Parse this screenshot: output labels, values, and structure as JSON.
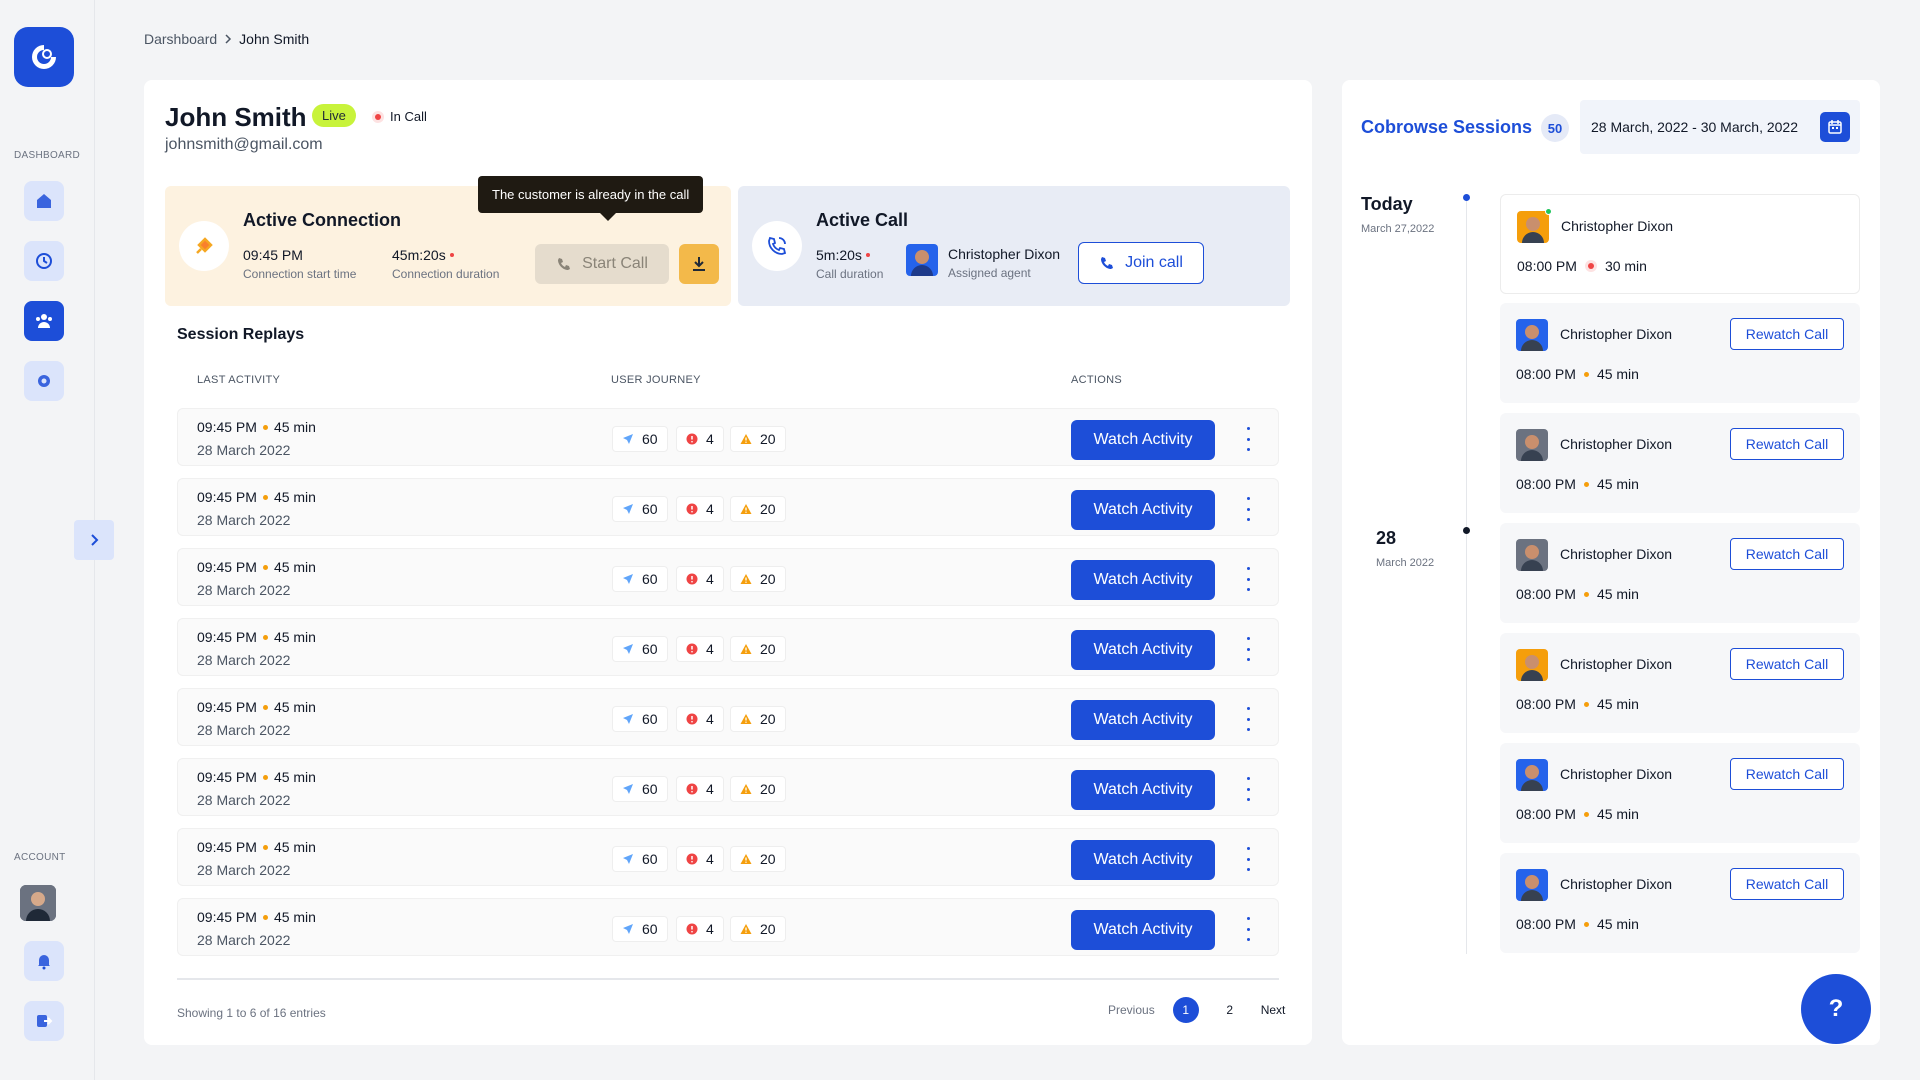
{
  "sidebar": {
    "dashboard_label": "DASHBOARD",
    "account_label": "ACCOUNT",
    "items": [
      {
        "icon": "home-icon"
      },
      {
        "icon": "clock-icon"
      },
      {
        "icon": "users-icon"
      },
      {
        "icon": "settings-icon"
      }
    ]
  },
  "breadcrumb": {
    "root": "Darshboard",
    "current": "John Smith"
  },
  "user": {
    "name": "John Smith",
    "status_badge": "Live",
    "call_status": "In Call",
    "email": "johnsmith@gmail.com"
  },
  "active_connection": {
    "title": "Active Connection",
    "start_time": "09:45 PM",
    "start_time_label": "Connection start time",
    "duration": "45m:20s",
    "duration_label": "Connection duration",
    "start_call_label": "Start Call",
    "tooltip": "The customer is already in the call"
  },
  "active_call": {
    "title": "Active Call",
    "duration": "5m:20s",
    "duration_label": "Call duration",
    "agent_name": "Christopher Dixon",
    "agent_label": "Assigned agent",
    "join_label": "Join call"
  },
  "session_replays": {
    "title": "Session Replays",
    "columns": [
      "LAST ACTIVITY",
      "USER JOURNEY",
      "ACTIONS"
    ],
    "rows": [
      {
        "time": "09:45 PM",
        "duration": "45 min",
        "date": "28 March 2022",
        "clicks": "60",
        "errors": "4",
        "warnings": "20",
        "action": "Watch Activity"
      },
      {
        "time": "09:45 PM",
        "duration": "45 min",
        "date": "28 March 2022",
        "clicks": "60",
        "errors": "4",
        "warnings": "20",
        "action": "Watch Activity"
      },
      {
        "time": "09:45 PM",
        "duration": "45 min",
        "date": "28 March 2022",
        "clicks": "60",
        "errors": "4",
        "warnings": "20",
        "action": "Watch Activity"
      },
      {
        "time": "09:45 PM",
        "duration": "45 min",
        "date": "28 March 2022",
        "clicks": "60",
        "errors": "4",
        "warnings": "20",
        "action": "Watch Activity"
      },
      {
        "time": "09:45 PM",
        "duration": "45 min",
        "date": "28 March 2022",
        "clicks": "60",
        "errors": "4",
        "warnings": "20",
        "action": "Watch Activity"
      },
      {
        "time": "09:45 PM",
        "duration": "45 min",
        "date": "28 March 2022",
        "clicks": "60",
        "errors": "4",
        "warnings": "20",
        "action": "Watch Activity"
      },
      {
        "time": "09:45 PM",
        "duration": "45 min",
        "date": "28 March 2022",
        "clicks": "60",
        "errors": "4",
        "warnings": "20",
        "action": "Watch Activity"
      },
      {
        "time": "09:45 PM",
        "duration": "45 min",
        "date": "28 March 2022",
        "clicks": "60",
        "errors": "4",
        "warnings": "20",
        "action": "Watch Activity"
      }
    ],
    "showing": "Showing 1 to 6 of 16 entries",
    "pagination": {
      "previous": "Previous",
      "pages": [
        "1",
        "2"
      ],
      "current": "1",
      "next": "Next"
    }
  },
  "cobrowse": {
    "title": "Cobrowse Sessions",
    "count": "50",
    "date_range": "28 March, 2022 - 30 March, 2022",
    "groups": [
      {
        "heading": "Today",
        "sub": "March 27,2022"
      },
      {
        "heading": "28",
        "sub": "March 2022"
      }
    ],
    "sessions": [
      {
        "name": "Christopher Dixon",
        "time": "08:00 PM",
        "duration": "30 min",
        "live": true,
        "action": ""
      },
      {
        "name": "Christopher Dixon",
        "time": "08:00 PM",
        "duration": "45 min",
        "live": false,
        "action": "Rewatch Call"
      },
      {
        "name": "Christopher Dixon",
        "time": "08:00 PM",
        "duration": "45 min",
        "live": false,
        "action": "Rewatch Call"
      },
      {
        "name": "Christopher Dixon",
        "time": "08:00 PM",
        "duration": "45 min",
        "live": false,
        "action": "Rewatch Call"
      },
      {
        "name": "Christopher Dixon",
        "time": "08:00 PM",
        "duration": "45 min",
        "live": false,
        "action": "Rewatch Call"
      },
      {
        "name": "Christopher Dixon",
        "time": "08:00 PM",
        "duration": "45 min",
        "live": false,
        "action": "Rewatch Call"
      },
      {
        "name": "Christopher Dixon",
        "time": "08:00 PM",
        "duration": "45 min",
        "live": false,
        "action": "Rewatch Call"
      }
    ]
  },
  "help_label": "?",
  "colors": {
    "primary": "#1d4ed8",
    "live": "#c8f33b",
    "connection_bg": "#fdf2e0",
    "call_bg": "#e8ecf5"
  }
}
